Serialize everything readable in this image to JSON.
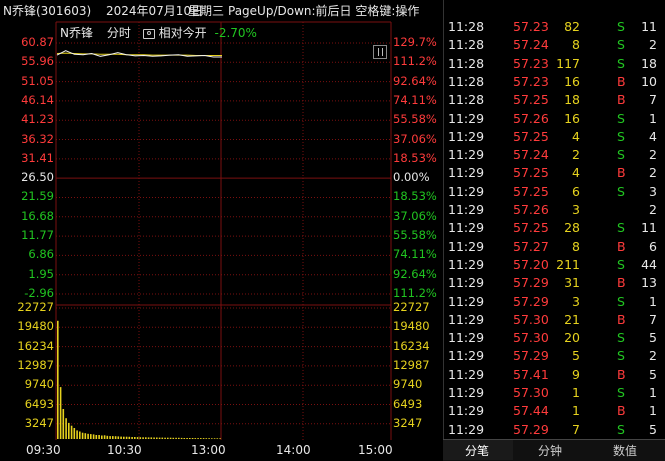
{
  "title_bar": {
    "stock": "N乔锋(301603)",
    "date": "2024年07月10日",
    "weekday": "星期三",
    "hint": "PageUp/Down:前后日 空格键:操作"
  },
  "chart_header": {
    "name": "N乔锋",
    "mode": "分时",
    "compare_label": "相对今开",
    "compare_value": "-2.70%"
  },
  "price_axis": [
    "60.87",
    "55.96",
    "51.05",
    "46.14",
    "41.23",
    "36.32",
    "31.41",
    "26.50",
    "21.59",
    "16.68",
    "11.77",
    "6.86",
    "1.95",
    "-2.96"
  ],
  "pct_axis": [
    "129.7%",
    "111.2%",
    "92.64%",
    "74.11%",
    "55.58%",
    "37.06%",
    "18.53%",
    "0.00%",
    "18.53%",
    "37.06%",
    "55.58%",
    "74.11%",
    "92.64%",
    "111.2%"
  ],
  "volume_axis": [
    "22727",
    "19480",
    "16234",
    "12987",
    "9740",
    "6493",
    "3247"
  ],
  "time_axis": [
    "09:30",
    "10:30",
    "13:00",
    "14:00",
    "15:00"
  ],
  "colors": {
    "up": "#ff3b3b",
    "down": "#21c521",
    "flat": "#e8e8e8",
    "volume": "#e6d21e",
    "grid": "#7a1010",
    "price_line": "#f2f2f2",
    "avg_line": "#e6d21e"
  },
  "chart_data": {
    "type": "line",
    "xlabel": "",
    "ylabel": "",
    "x": [
      "09:30",
      "09:35",
      "09:40",
      "09:45",
      "09:50",
      "09:55",
      "10:00",
      "10:10",
      "10:20",
      "10:30",
      "10:40",
      "10:50",
      "11:00",
      "11:10",
      "11:20",
      "11:30",
      "13:00",
      "13:10",
      "13:20",
      "13:30"
    ],
    "series": [
      {
        "values": [
          57.8,
          58.9,
          58.0,
          57.9,
          58.2,
          57.5,
          57.9,
          58.4,
          57.9,
          57.6,
          57.7,
          57.5,
          57.6,
          57.8,
          57.9,
          57.5,
          57.6,
          57.7,
          57.3,
          57.3
        ]
      },
      {
        "values": [
          58.2,
          58.3,
          58.2,
          58.1,
          58.1,
          58.0,
          58.0,
          58.0,
          57.9,
          57.9,
          57.9,
          57.8,
          57.8,
          57.8,
          57.8,
          57.8,
          57.7,
          57.7,
          57.7,
          57.7
        ]
      }
    ],
    "ylim": [
      -2.96,
      60.87
    ],
    "volume": {
      "type": "bar",
      "ylim": [
        0,
        22727
      ],
      "values": [
        20500,
        9000,
        5200,
        3600,
        2800,
        2300,
        1900,
        1500,
        1300,
        1100,
        1000,
        900,
        850,
        800,
        700,
        700,
        600,
        650,
        550,
        500,
        500,
        480,
        450,
        420,
        400,
        400,
        380,
        350,
        350,
        330,
        320,
        300,
        300,
        280,
        280,
        260,
        260,
        250,
        240,
        230,
        230,
        220,
        210,
        200,
        200,
        190,
        180,
        180,
        170,
        170,
        160,
        160,
        150,
        150,
        140,
        140,
        130,
        130,
        120,
        120
      ]
    }
  },
  "trades": [
    {
      "time": "11:28",
      "price": "57.23",
      "vol": "82",
      "side": "S",
      "count": "11"
    },
    {
      "time": "11:28",
      "price": "57.24",
      "vol": "8",
      "side": "S",
      "count": "2"
    },
    {
      "time": "11:28",
      "price": "57.23",
      "vol": "117",
      "side": "S",
      "count": "18"
    },
    {
      "time": "11:28",
      "price": "57.23",
      "vol": "16",
      "side": "B",
      "count": "10"
    },
    {
      "time": "11:28",
      "price": "57.25",
      "vol": "18",
      "side": "B",
      "count": "7"
    },
    {
      "time": "11:29",
      "price": "57.26",
      "vol": "16",
      "side": "S",
      "count": "1"
    },
    {
      "time": "11:29",
      "price": "57.25",
      "vol": "4",
      "side": "S",
      "count": "4"
    },
    {
      "time": "11:29",
      "price": "57.24",
      "vol": "2",
      "side": "S",
      "count": "2"
    },
    {
      "time": "11:29",
      "price": "57.25",
      "vol": "4",
      "side": "B",
      "count": "2"
    },
    {
      "time": "11:29",
      "price": "57.25",
      "vol": "6",
      "side": "S",
      "count": "3"
    },
    {
      "time": "11:29",
      "price": "57.26",
      "vol": "3",
      "side": "",
      "count": "2"
    },
    {
      "time": "11:29",
      "price": "57.25",
      "vol": "28",
      "side": "S",
      "count": "11"
    },
    {
      "time": "11:29",
      "price": "57.27",
      "vol": "8",
      "side": "B",
      "count": "6"
    },
    {
      "time": "11:29",
      "price": "57.20",
      "vol": "211",
      "side": "S",
      "count": "44"
    },
    {
      "time": "11:29",
      "price": "57.29",
      "vol": "31",
      "side": "B",
      "count": "13"
    },
    {
      "time": "11:29",
      "price": "57.29",
      "vol": "3",
      "side": "S",
      "count": "1"
    },
    {
      "time": "11:29",
      "price": "57.30",
      "vol": "21",
      "side": "B",
      "count": "7"
    },
    {
      "time": "11:29",
      "price": "57.30",
      "vol": "20",
      "side": "S",
      "count": "5"
    },
    {
      "time": "11:29",
      "price": "57.29",
      "vol": "5",
      "side": "S",
      "count": "2"
    },
    {
      "time": "11:29",
      "price": "57.41",
      "vol": "9",
      "side": "B",
      "count": "5"
    },
    {
      "time": "11:29",
      "price": "57.30",
      "vol": "1",
      "side": "S",
      "count": "1"
    },
    {
      "time": "11:29",
      "price": "57.44",
      "vol": "1",
      "side": "B",
      "count": "1"
    },
    {
      "time": "11:29",
      "price": "57.29",
      "vol": "7",
      "side": "S",
      "count": "5"
    }
  ],
  "tabs": [
    "分笔",
    "分钟",
    "数值"
  ]
}
